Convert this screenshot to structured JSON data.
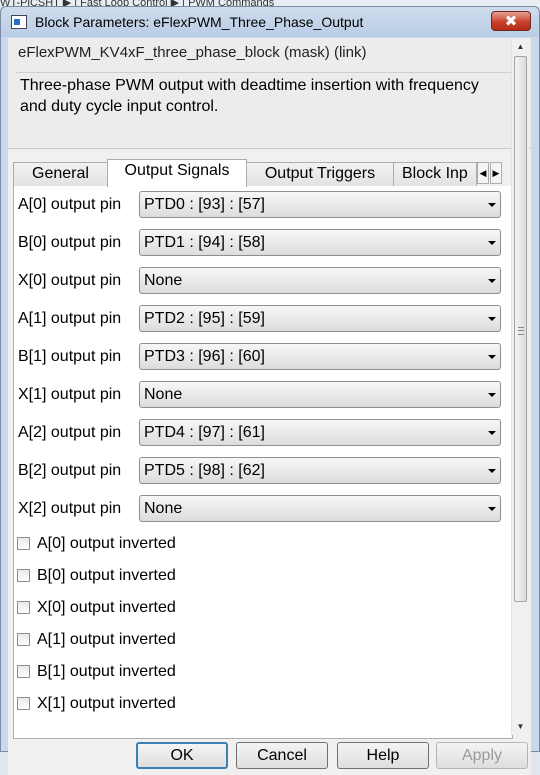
{
  "breadcrumb": "WT-PiCSHT ▶ | Fast Loop Control ▶ | PWM Commands",
  "window": {
    "title": "Block Parameters: eFlexPWM_Three_Phase_Output",
    "close_glyph": "✖"
  },
  "mask": {
    "title": "eFlexPWM_KV4xF_three_phase_block (mask) (link)",
    "description": "Three-phase PWM output with deadtime insertion with frequency and duty cycle input control."
  },
  "tabs": [
    {
      "label": "General"
    },
    {
      "label": "Output Signals"
    },
    {
      "label": "Output Triggers"
    },
    {
      "label": "Block Inp"
    }
  ],
  "tab_scroll": {
    "left": "◀",
    "right": "▶"
  },
  "pins": [
    {
      "label": "A[0] output pin",
      "value": "PTD0 : [93] : [57]"
    },
    {
      "label": "B[0] output pin",
      "value": "PTD1 : [94] : [58]"
    },
    {
      "label": "X[0] output pin",
      "value": "None"
    },
    {
      "label": "A[1] output pin",
      "value": "PTD2 : [95] : [59]"
    },
    {
      "label": "B[1] output pin",
      "value": "PTD3 : [96] : [60]"
    },
    {
      "label": "X[1] output pin",
      "value": "None"
    },
    {
      "label": "A[2] output pin",
      "value": "PTD4 : [97] : [61]"
    },
    {
      "label": "B[2] output pin",
      "value": "PTD5 : [98] : [62]"
    },
    {
      "label": "X[2] output pin",
      "value": "None"
    }
  ],
  "inverted": [
    {
      "label": "A[0] output inverted",
      "checked": false
    },
    {
      "label": "B[0] output inverted",
      "checked": false
    },
    {
      "label": "X[0] output inverted",
      "checked": false
    },
    {
      "label": "A[1] output inverted",
      "checked": false
    },
    {
      "label": "B[1] output inverted",
      "checked": false
    },
    {
      "label": "X[1] output inverted",
      "checked": false
    }
  ],
  "scrollbar": {
    "up": "▲",
    "down": "▼"
  },
  "buttons": {
    "ok": "OK",
    "cancel": "Cancel",
    "help": "Help",
    "apply": "Apply"
  }
}
